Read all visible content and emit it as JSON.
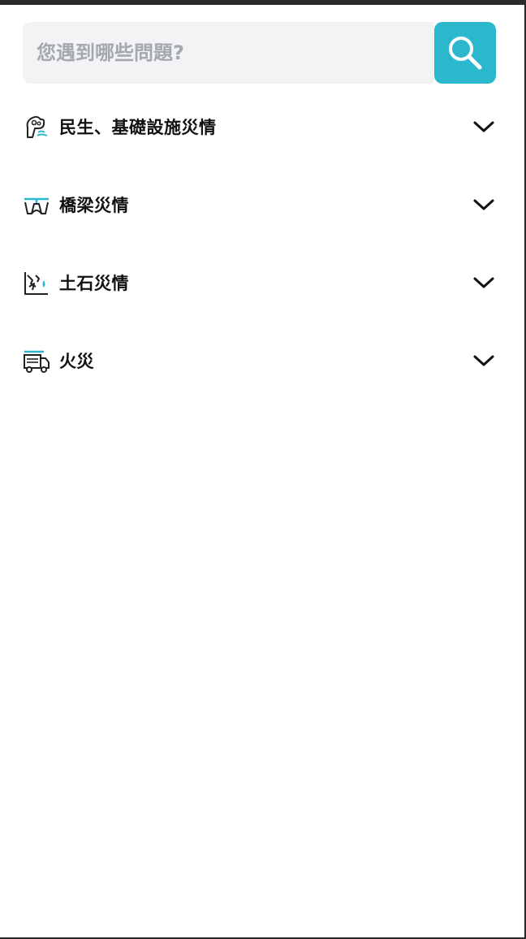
{
  "search": {
    "placeholder": "您遇到哪些問題?"
  },
  "accent_color": "#2bb8cc",
  "categories": [
    {
      "label": "民生、基礎設施災情",
      "icon": "livelihood-infrastructure-icon"
    },
    {
      "label": "橋梁災情",
      "icon": "bridge-icon"
    },
    {
      "label": "土石災情",
      "icon": "landslide-icon"
    },
    {
      "label": "火災",
      "icon": "fire-truck-icon"
    }
  ]
}
